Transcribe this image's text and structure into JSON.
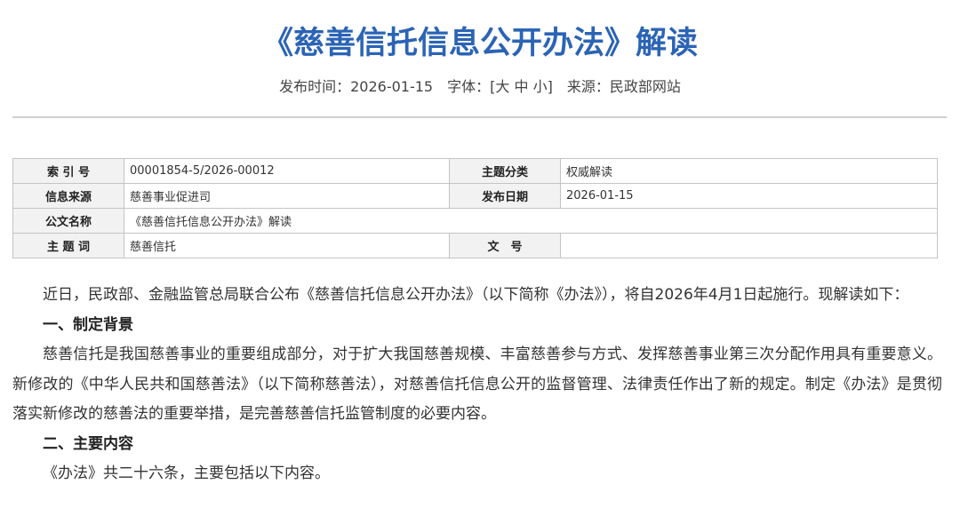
{
  "article": {
    "title": "《慈善信托信息公开办法》解读",
    "meta": {
      "publish_label": "发布时间：",
      "publish_date": "2026-01-15",
      "font_label": "字体：",
      "bracket_open": "[",
      "size_large": "大",
      "size_medium": "中",
      "size_small": "小",
      "bracket_close": "]",
      "source_label": "来源：",
      "source": "民政部网站"
    }
  },
  "info_table": {
    "index_label": "索 引 号",
    "index_value": "00001854-5/2026-00012",
    "category_label": "主题分类",
    "category_value": "权威解读",
    "origin_label": "信息来源",
    "origin_value": "慈善事业促进司",
    "date_label": "发布日期",
    "date_value": "2026-01-15",
    "doc_name_label": "公文名称",
    "doc_name_value": "《慈善信托信息公开办法》解读",
    "keyword_label": "主 题 词",
    "keyword_value": "慈善信托",
    "doc_no_label": "文　号",
    "doc_no_value": ""
  },
  "content": {
    "intro": "近日，民政部、金融监管总局联合公布《慈善信托信息公开办法》（以下简称《办法》），将自2026年4月1日起施行。现解读如下：",
    "section1_heading": "一、制定背景",
    "section1_body": "慈善信托是我国慈善事业的重要组成部分，对于扩大我国慈善规模、丰富慈善参与方式、发挥慈善事业第三次分配作用具有重要意义。新修改的《中华人民共和国慈善法》（以下简称慈善法），对慈善信托信息公开的监督管理、法律责任作出了新的规定。制定《办法》是贯彻落实新修改的慈善法的重要举措，是完善慈善信托监管制度的必要内容。",
    "section2_heading": "二、主要内容",
    "section2_body": "《办法》共二十六条，主要包括以下内容。"
  },
  "colors": {
    "title": "#2b64b5",
    "label_bg": "#f2f2f2",
    "border": "#c4c4c4"
  }
}
